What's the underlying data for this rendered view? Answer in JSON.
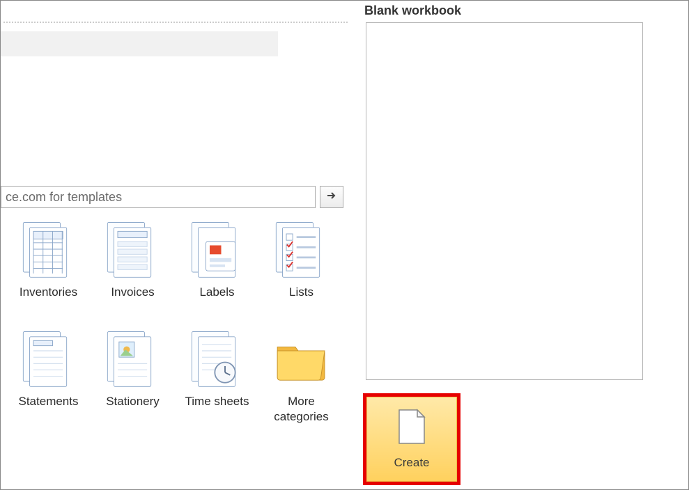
{
  "search": {
    "value": "ce.com for templates"
  },
  "templates": [
    {
      "key": "inventories",
      "label": "Inventories",
      "icon": "inventory"
    },
    {
      "key": "invoices",
      "label": "Invoices",
      "icon": "invoice"
    },
    {
      "key": "labels",
      "label": "Labels",
      "icon": "label"
    },
    {
      "key": "lists",
      "label": "Lists",
      "icon": "list"
    },
    {
      "key": "statements",
      "label": "Statements",
      "icon": "statement"
    },
    {
      "key": "stationery",
      "label": "Stationery",
      "icon": "stationery"
    },
    {
      "key": "timesheets",
      "label": "Time sheets",
      "icon": "timesheet"
    },
    {
      "key": "more",
      "label": "More\ncategories",
      "icon": "folder"
    }
  ],
  "preview": {
    "title": "Blank workbook"
  },
  "create": {
    "label": "Create"
  }
}
